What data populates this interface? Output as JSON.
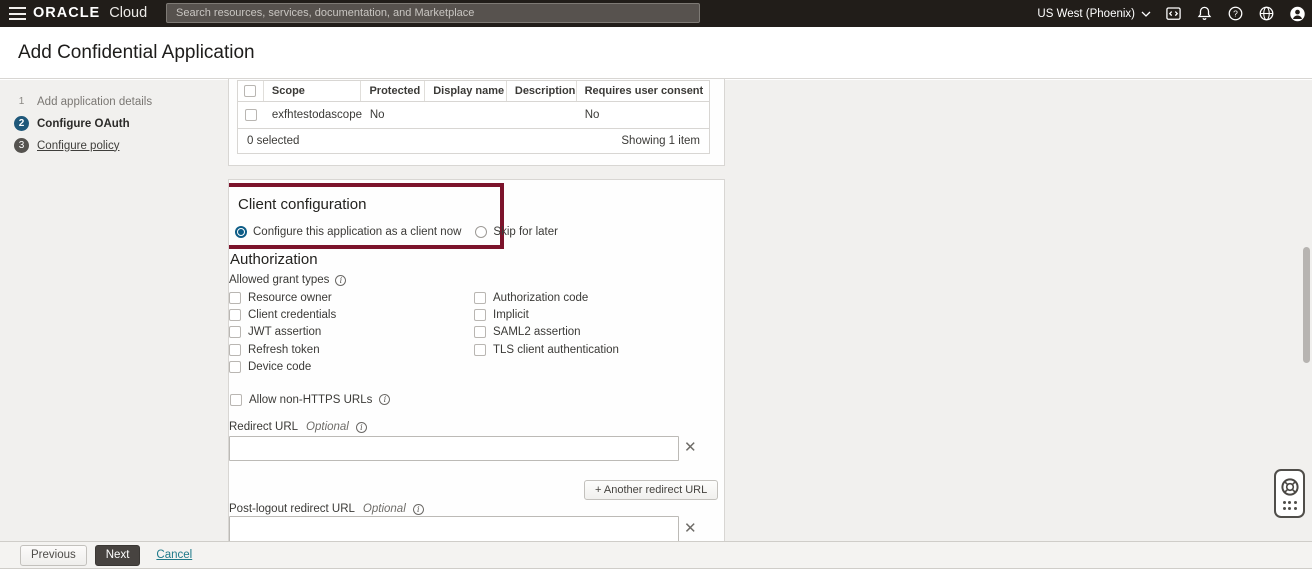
{
  "topbar": {
    "brand": "ORACLE",
    "brand_suffix": "Cloud",
    "search_placeholder": "Search resources, services, documentation, and Marketplace",
    "region": "US West (Phoenix)"
  },
  "page": {
    "title": "Add Confidential Application"
  },
  "steps": [
    {
      "num": "1",
      "label": "Add application details"
    },
    {
      "num": "2",
      "label": "Configure OAuth"
    },
    {
      "num": "3",
      "label": "Configure policy"
    }
  ],
  "scope_table": {
    "headers": [
      "Scope",
      "Protected",
      "Display name",
      "Description",
      "Requires user consent"
    ],
    "row": {
      "scope": "exfhtestodascope",
      "protected": "No",
      "display_name": "",
      "description": "",
      "requires_user_consent": "No"
    },
    "selected_summary": "0 selected",
    "showing_summary": "Showing 1 item"
  },
  "client_configuration": {
    "heading": "Client configuration",
    "radio_selected": "Configure this application as a client now",
    "radio_unselected": "Skip for later"
  },
  "authorization": {
    "heading": "Authorization",
    "allowed_grant_types_label": "Allowed grant types",
    "grant_types_left": [
      "Resource owner",
      "Client credentials",
      "JWT assertion",
      "Refresh token",
      "Device code"
    ],
    "grant_types_right": [
      "Authorization code",
      "Implicit",
      "SAML2 assertion",
      "TLS client authentication"
    ],
    "allow_non_https_label": "Allow non-HTTPS URLs",
    "redirect_url_label": "Redirect URL",
    "redirect_url_optional": "Optional",
    "redirect_url_value": "",
    "another_redirect_url_button": "+ Another redirect URL",
    "post_logout_redirect_url_label": "Post-logout redirect URL",
    "post_logout_optional": "Optional",
    "post_logout_value": ""
  },
  "wizard_footer": {
    "previous": "Previous",
    "next": "Next",
    "cancel": "Cancel"
  },
  "colors": {
    "topbar_bg": "#211d19",
    "highlight_border": "#7c132b",
    "active_step": "#1f587a",
    "radio_selected": "#0d5c86",
    "link": "#1f7a8a"
  }
}
